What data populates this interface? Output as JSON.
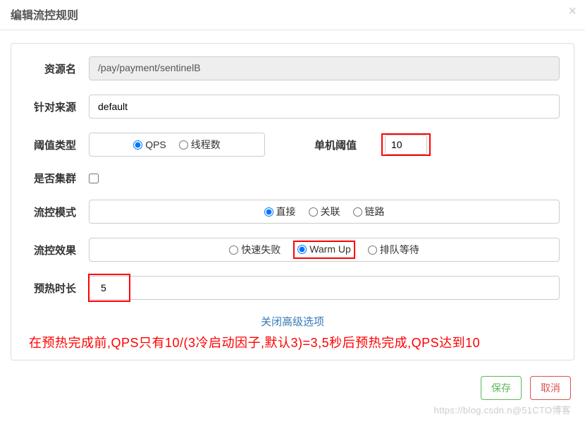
{
  "header": {
    "title": "编辑流控规则"
  },
  "form": {
    "resource": {
      "label": "资源名",
      "value": "/pay/payment/sentinelB"
    },
    "source": {
      "label": "针对来源",
      "value": "default"
    },
    "thresholdType": {
      "label": "阈值类型",
      "options": {
        "qps": "QPS",
        "threads": "线程数"
      },
      "thresholdLabel": "单机阈值",
      "thresholdValue": "10"
    },
    "cluster": {
      "label": "是否集群"
    },
    "mode": {
      "label": "流控模式",
      "options": {
        "direct": "直接",
        "relate": "关联",
        "chain": "链路"
      }
    },
    "effect": {
      "label": "流控效果",
      "options": {
        "fast": "快速失败",
        "warmup": "Warm Up",
        "queue": "排队等待"
      }
    },
    "warmupTime": {
      "label": "预热时长",
      "value": "5"
    }
  },
  "advanced": {
    "toggleLabel": "关闭高级选项"
  },
  "annotation": "在预热完成前,QPS只有10/(3冷启动因子,默认3)=3,5秒后预热完成,QPS达到10",
  "buttons": {
    "save": "保存",
    "cancel": "取消"
  },
  "watermark": "https://blog.csdn.n@51CTO博客"
}
